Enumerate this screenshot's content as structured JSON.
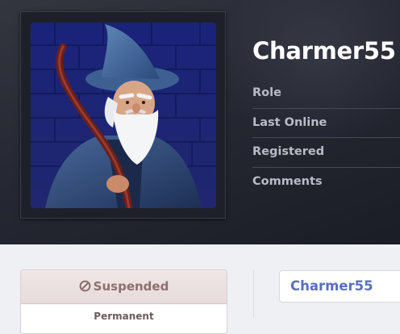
{
  "profile": {
    "username": "Charmer55",
    "stats": [
      {
        "label": "Role"
      },
      {
        "label": "Last Online"
      },
      {
        "label": "Registered"
      },
      {
        "label": "Comments"
      }
    ]
  },
  "status_card": {
    "title": "Suspended",
    "icon": "ban-icon",
    "detail": "Permanent",
    "color": "#8d6f6f"
  },
  "name_box": {
    "username": "Charmer55",
    "color": "#5a6ebf"
  },
  "avatar": {
    "icon": "wizard-avatar"
  }
}
